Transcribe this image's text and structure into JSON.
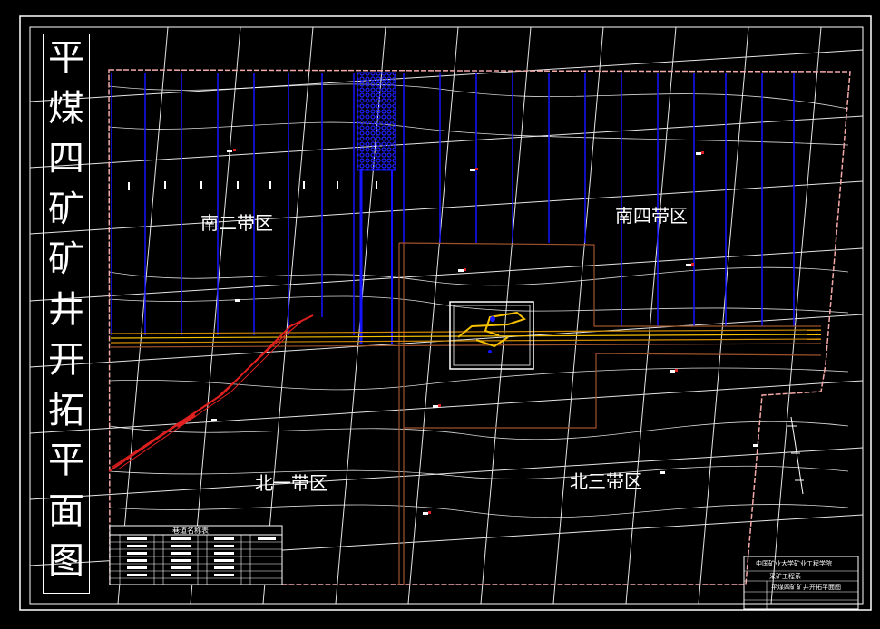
{
  "title_vertical": [
    "平",
    "煤",
    "四",
    "矿",
    "矿",
    "井",
    "开",
    "拓",
    "平",
    "面",
    "图"
  ],
  "zones": {
    "south_two": "南二带区",
    "south_four": "南四带区",
    "north_one": "北一带区",
    "north_three": "北三带区"
  },
  "legend_table": {
    "title": "巷道名称表"
  },
  "title_block": {
    "line1": "中国矿业大学矿业工程学院",
    "line2": "采矿工程系",
    "line3": "平煤四矿矿井开拓平面图"
  },
  "colors": {
    "background": "#000000",
    "frame": "#ffffff",
    "boundary": "#f4a9a9",
    "blue_lines": "#1414ff",
    "red_roadway": "#e02020",
    "yellow_roadway": "#f5c000",
    "brown_lines": "#a0522d"
  }
}
